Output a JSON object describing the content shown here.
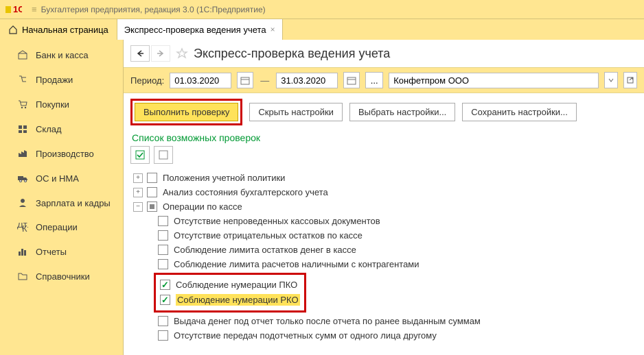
{
  "title": "Бухгалтерия предприятия, редакция 3.0  (1С:Предприятие)",
  "tabs": {
    "home": "Начальная страница",
    "active": "Экспресс-проверка ведения учета"
  },
  "sidebar": {
    "items": [
      {
        "label": "Банк и касса"
      },
      {
        "label": "Продажи"
      },
      {
        "label": "Покупки"
      },
      {
        "label": "Склад"
      },
      {
        "label": "Производство"
      },
      {
        "label": "ОС и НМА"
      },
      {
        "label": "Зарплата и кадры"
      },
      {
        "label": "Операции"
      },
      {
        "label": "Отчеты"
      },
      {
        "label": "Справочники"
      }
    ]
  },
  "page": {
    "title": "Экспресс-проверка ведения учета"
  },
  "period": {
    "label": "Период:",
    "from": "01.03.2020",
    "dash": "—",
    "to": "31.03.2020",
    "dots": "...",
    "org": "Конфетпром ООО"
  },
  "actions": {
    "run": "Выполнить проверку",
    "hide": "Скрыть настройки",
    "choose": "Выбрать настройки...",
    "save": "Сохранить настройки..."
  },
  "list": {
    "header": "Список возможных проверок",
    "items": [
      {
        "label": "Положения учетной политики",
        "checked": false,
        "expand": "plus",
        "indent": 0
      },
      {
        "label": "Анализ состояния бухгалтерского учета",
        "checked": false,
        "expand": "plus",
        "indent": 0
      },
      {
        "label": "Операции по кассе",
        "checked": "partial",
        "expand": "minus",
        "indent": 0
      },
      {
        "label": "Отсутствие непроведенных кассовых документов",
        "checked": false,
        "indent": 1
      },
      {
        "label": "Отсутствие отрицательных остатков по кассе",
        "checked": false,
        "indent": 1
      },
      {
        "label": "Соблюдение лимита остатков денег в кассе",
        "checked": false,
        "indent": 1
      },
      {
        "label": "Соблюдение лимита расчетов наличными с контрагентами",
        "checked": false,
        "indent": 1
      },
      {
        "label": "Соблюдение нумерации ПКО",
        "checked": true,
        "indent": 1,
        "highlighted": true
      },
      {
        "label": "Соблюдение нумерации РКО",
        "checked": true,
        "indent": 1,
        "highlighted": true
      },
      {
        "label": "Выдача денег под отчет только после отчета по ранее выданным суммам",
        "checked": false,
        "indent": 1
      },
      {
        "label": "Отсутствие передач подотчетных сумм от одного лица другому",
        "checked": false,
        "indent": 1
      }
    ]
  }
}
